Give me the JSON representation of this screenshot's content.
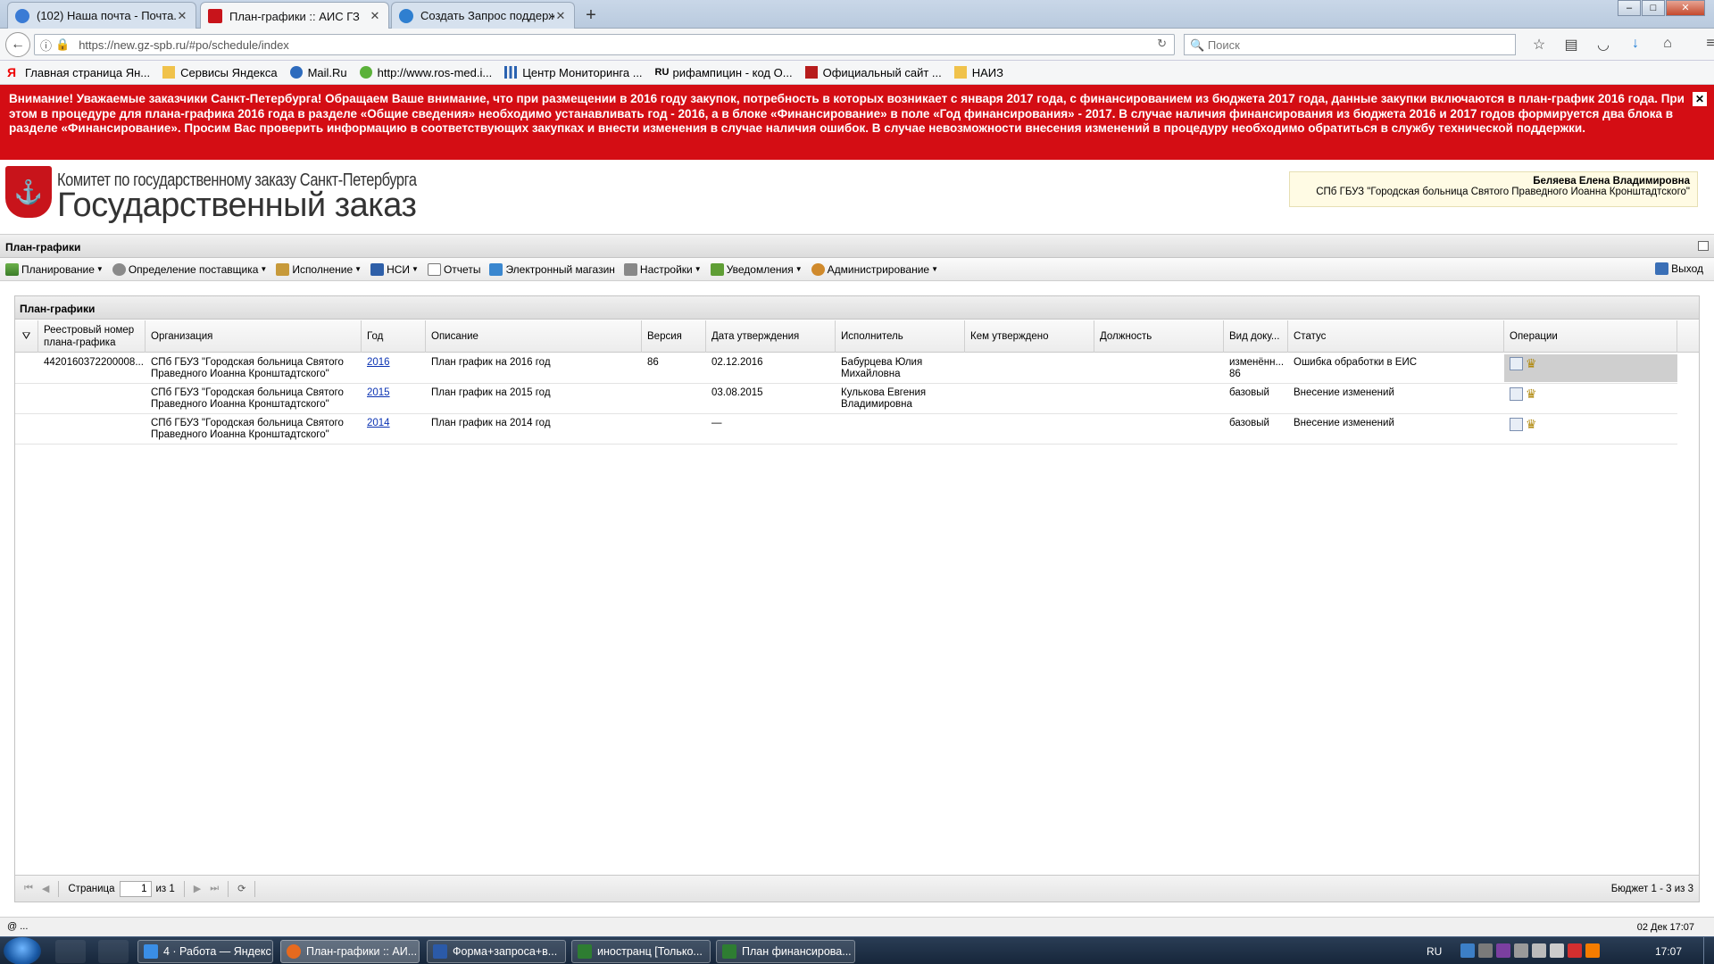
{
  "browser": {
    "tabs": [
      {
        "title": "(102) Наша почта - Почта...",
        "active": false
      },
      {
        "title": "План-графики :: АИС ГЗ",
        "active": true
      },
      {
        "title": "Создать Запрос поддержк...",
        "active": false
      }
    ],
    "url": "https://new.gz-spb.ru/#po/schedule/index",
    "search_placeholder": "Поиск",
    "bookmarks": [
      "Главная страница Ян...",
      "Сервисы Яндекса",
      "Mail.Ru",
      "http://www.ros-med.i...",
      "Центр Мониторинга ...",
      "рифампицин - код О...",
      "Официальный сайт ...",
      "НАИЗ"
    ]
  },
  "notice": {
    "text": "Внимание! Уважаемые заказчики Санкт-Петербурга! Обращаем Ваше внимание, что при размещении в 2016 году закупок, потребность в которых возникает с января 2017 года, с финансированием из бюджета 2017 года, данные закупки включаются в план-график 2016 года. При этом в процедуре для плана-графика 2016 года в разделе «Общие сведения» необходимо устанавливать год - 2016, а в блоке «Финансирование» в поле «Год финансирования» - 2017. В случае наличия финансирования из бюджета 2016 и 2017 годов формируется два блока в разделе «Финансирование». Просим Вас проверить информацию в соответствующих закупках и внести изменения в случае наличия ошибок. В случае невозможности внесения изменений в процедуру необходимо обратиться в службу технической поддержки."
  },
  "header": {
    "org_line1": "Комитет по государственному заказу Санкт-Петербурга",
    "org_line2": "Государственный заказ",
    "user_name": "Беляева Елена Владимировна",
    "user_org": "СПб ГБУЗ \"Городская больница Святого Праведного Иоанна Кронштадтского\""
  },
  "panel_title": "План-графики",
  "menu": [
    "Планирование",
    "Определение поставщика",
    "Исполнение",
    "НСИ",
    "Отчеты",
    "Электронный магазин",
    "Настройки",
    "Уведомления",
    "Администрирование"
  ],
  "logout_label": "Выход",
  "grid": {
    "title": "План-графики",
    "columns": [
      "Реестровый номер плана-графика",
      "Организация",
      "Год",
      "Описание",
      "Версия",
      "Дата утверждения",
      "Исполнитель",
      "Кем утверждено",
      "Должность",
      "Вид доку...",
      "Статус",
      "Операции"
    ],
    "rows": [
      {
        "reg": "4420160372200008...",
        "org": "СПб ГБУЗ \"Городская больница Святого Праведного Иоанна Кронштадтского\"",
        "year": "2016",
        "desc": "План график на 2016 год",
        "ver": "86",
        "date": "02.12.2016",
        "exec": "Бабурцева Юлия Михайловна",
        "appr": "",
        "pos": "",
        "kind": "изменённ... 86",
        "status": "Ошибка обработки в ЕИС"
      },
      {
        "reg": "",
        "org": "СПб ГБУЗ \"Городская больница Святого Праведного Иоанна Кронштадтского\"",
        "year": "2015",
        "desc": "План график на 2015 год",
        "ver": "",
        "date": "03.08.2015",
        "exec": "Кулькова Евгения Владимировна",
        "appr": "",
        "pos": "",
        "kind": "базовый",
        "status": "Внесение изменений"
      },
      {
        "reg": "",
        "org": "СПб ГБУЗ \"Городская больница Святого Праведного Иоанна Кронштадтского\"",
        "year": "2014",
        "desc": "План график на 2014 год",
        "ver": "",
        "date": "—",
        "exec": "",
        "appr": "",
        "pos": "",
        "kind": "базовый",
        "status": "Внесение изменений"
      }
    ],
    "pager": {
      "page_label": "Страница",
      "page": "1",
      "of_label": "из 1",
      "info": "Бюджет 1 - 3 из 3"
    }
  },
  "statusbar": {
    "left": "@ ...",
    "datetime": "02 Дек 17:07"
  },
  "taskbar": {
    "items": [
      "4 · Работа — Яндекс...",
      "План-графики :: АИ...",
      "Форма+запроса+в...",
      "иностранц [Только...",
      "План финансирова..."
    ],
    "lang": "RU",
    "clock": "17:07"
  }
}
